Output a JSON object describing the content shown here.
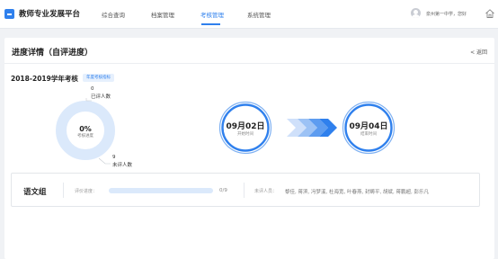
{
  "header": {
    "app_title": "教师专业发展平台",
    "nav": [
      {
        "label": "综合查询",
        "active": false
      },
      {
        "label": "档案管理",
        "active": false
      },
      {
        "label": "考核管理",
        "active": true
      },
      {
        "label": "系统管理",
        "active": false
      }
    ],
    "user_text": "泉州第一中学，您好",
    "icons": {
      "logo": "app-logo-icon",
      "avatar": "user-avatar-icon",
      "home": "home-icon"
    }
  },
  "page": {
    "title": "进度详情（自评进度）",
    "back_label": "< 返回"
  },
  "assessment": {
    "year_title": "2018-2019学年考核",
    "tag": "年度考核指标",
    "donut": {
      "percent_text": "0%",
      "percent_caption": "考核进度",
      "rated_count": "0",
      "rated_label": "已评人数",
      "unrated_count": "9",
      "unrated_label": "未评人数",
      "rated_fraction": 0
    },
    "start": {
      "date": "09月02日",
      "label": "开始时间"
    },
    "end": {
      "date": "09月04日",
      "label": "结束时间"
    }
  },
  "groups": [
    {
      "name": "语文组",
      "progress_label": "评价进度：",
      "progress_fraction": 0,
      "progress_text": "0/9",
      "unrated_label": "未评人员：",
      "unrated_names": "黎佳, 蒋滨, 冯梦溪, 杜海宽, 叶春燕, 封畴平, 胡斌, 蒋鹏超, 彭乐凡"
    }
  ],
  "colors": {
    "accent": "#2f80ed",
    "donut_empty": "#dbe9fb",
    "ring_outer": "#7fb1f2",
    "arrow_light": "#b8d2f7"
  }
}
